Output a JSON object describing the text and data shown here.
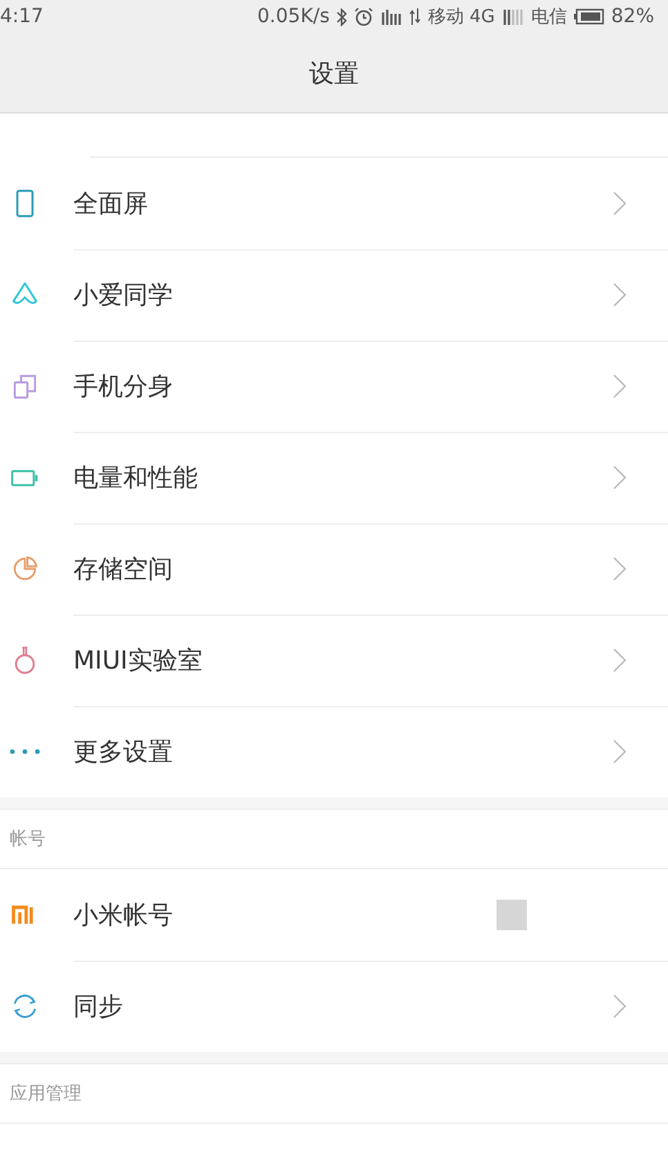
{
  "status_bar": {
    "time": "4:17",
    "speed": "0.05K/s",
    "carrier_1": "移动 4G",
    "carrier_2": "电信",
    "battery": "82%"
  },
  "header": {
    "title": "设置"
  },
  "sections": [
    {
      "items": [
        {
          "label": "全面屏",
          "chevron": true
        },
        {
          "label": "小爱同学",
          "chevron": true
        },
        {
          "label": "手机分身",
          "chevron": true
        },
        {
          "label": "电量和性能",
          "chevron": true
        },
        {
          "label": "存储空间",
          "chevron": true
        },
        {
          "label": "MIUI实验室",
          "chevron": true
        },
        {
          "label": "更多设置",
          "chevron": true
        }
      ]
    },
    {
      "title": "帐号",
      "items": [
        {
          "label": "小米帐号",
          "chevron": false,
          "avatar": true
        },
        {
          "label": "同步",
          "chevron": true
        }
      ]
    },
    {
      "title": "应用管理"
    }
  ]
}
